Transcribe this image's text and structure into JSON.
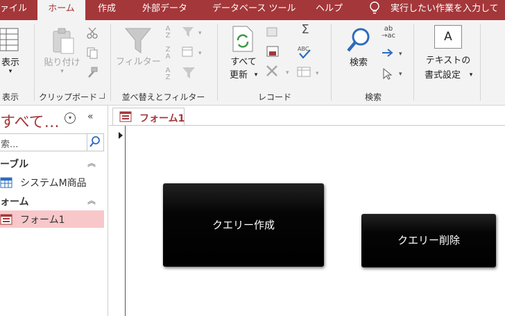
{
  "menu": {
    "tabs": [
      "ァイル",
      "ホーム",
      "作成",
      "外部データ",
      "データベース ツール",
      "ヘルプ"
    ],
    "active": "ホーム",
    "tell_me": "実行したい作業を入力して"
  },
  "ribbon": {
    "view": {
      "label": "表示",
      "group": "表示"
    },
    "clipboard": {
      "paste": "貼り付け",
      "group": "クリップボード"
    },
    "sort_filter": {
      "filter": "フィルター",
      "group": "並べ替えとフィルター"
    },
    "records": {
      "refresh": "すべて",
      "refresh2": "更新",
      "group": "レコード"
    },
    "find": {
      "find": "検索",
      "group": "検索"
    },
    "text_format": {
      "line1": "テキストの",
      "line2": "書式設定",
      "font_glyph": "A"
    }
  },
  "nav": {
    "title": "すべて…",
    "search_placeholder": "索...",
    "sections": [
      {
        "label": "ーブル",
        "items": [
          "システムM商品"
        ]
      },
      {
        "label": "ォーム",
        "items": [
          "フォーム1"
        ]
      }
    ]
  },
  "document": {
    "tab": "フォーム1",
    "buttons": [
      "クエリー作成",
      "クエリー削除"
    ]
  },
  "colors": {
    "accent": "#a4373a",
    "ribbon_bg": "#f3f3f3",
    "selected_item": "#f8c7c9"
  }
}
